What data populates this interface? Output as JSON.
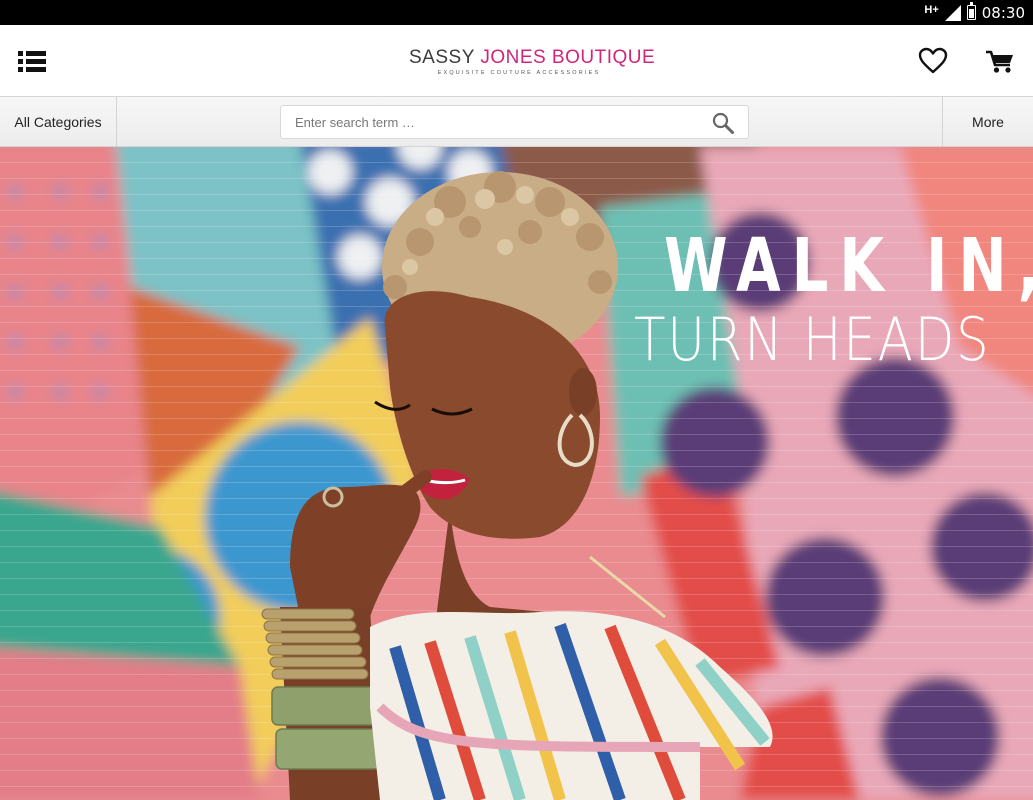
{
  "status_bar": {
    "network": "H+",
    "time": "08:30"
  },
  "header": {
    "logo": {
      "part1": "SASSY ",
      "part2": "JONES BOUTIQUE",
      "tagline": "EXQUISITE COUTURE ACCESSORIES"
    },
    "icons": [
      "menu-icon",
      "heart-icon",
      "cart-icon"
    ]
  },
  "search_bar": {
    "categories_label": "All Categories",
    "placeholder": "Enter search term …",
    "more_label": "More"
  },
  "hero": {
    "headline_line1": "WALK IN,",
    "headline_line2": "TURN HEADS"
  },
  "colors": {
    "brand_pink": "#d0257a",
    "logo_dark": "#3c3c3c",
    "status_bar": "#000000"
  }
}
